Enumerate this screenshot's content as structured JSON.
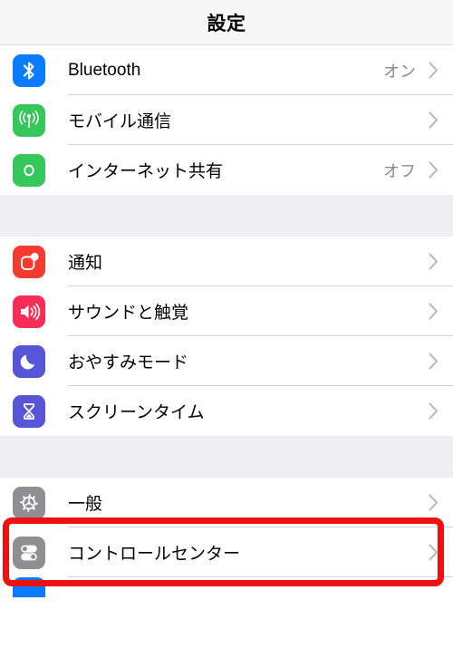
{
  "navbar": {
    "title": "設定"
  },
  "groups": [
    {
      "id": "connectivity",
      "rows": [
        {
          "name": "bluetooth",
          "label": "Bluetooth",
          "value": "オン",
          "icon": "bluetooth-icon",
          "icon_color": "#0A7CFF"
        },
        {
          "name": "cellular",
          "label": "モバイル通信",
          "value": "",
          "icon": "cellular-antenna-icon",
          "icon_color": "#35C759"
        },
        {
          "name": "personal-hotspot",
          "label": "インターネット共有",
          "value": "オフ",
          "icon": "hotspot-link-icon",
          "icon_color": "#35C759"
        }
      ]
    },
    {
      "id": "alerts",
      "rows": [
        {
          "name": "notifications",
          "label": "通知",
          "value": "",
          "icon": "notification-badge-icon",
          "icon_color": "#F53B30"
        },
        {
          "name": "sounds-haptics",
          "label": "サウンドと触覚",
          "value": "",
          "icon": "speaker-waves-icon",
          "icon_color": "#F62D55"
        },
        {
          "name": "do-not-disturb",
          "label": "おやすみモード",
          "value": "",
          "icon": "crescent-moon-icon",
          "icon_color": "#5754D6"
        },
        {
          "name": "screen-time",
          "label": "スクリーンタイム",
          "value": "",
          "icon": "hourglass-icon",
          "icon_color": "#5754D6"
        }
      ]
    },
    {
      "id": "system",
      "rows": [
        {
          "name": "general",
          "label": "一般",
          "value": "",
          "icon": "gear-icon",
          "icon_color": "#8E8E93"
        },
        {
          "name": "control-center",
          "label": "コントロールセンター",
          "value": "",
          "icon": "toggles-icon",
          "icon_color": "#8E8E93"
        },
        {
          "name": "display-brightness",
          "label": "",
          "value": "",
          "icon": "display-icon",
          "icon_color": "#0A7CFF"
        }
      ]
    }
  ],
  "annotation": {
    "name": "general-row-highlight",
    "color": "#EE1111",
    "target": "一般"
  }
}
